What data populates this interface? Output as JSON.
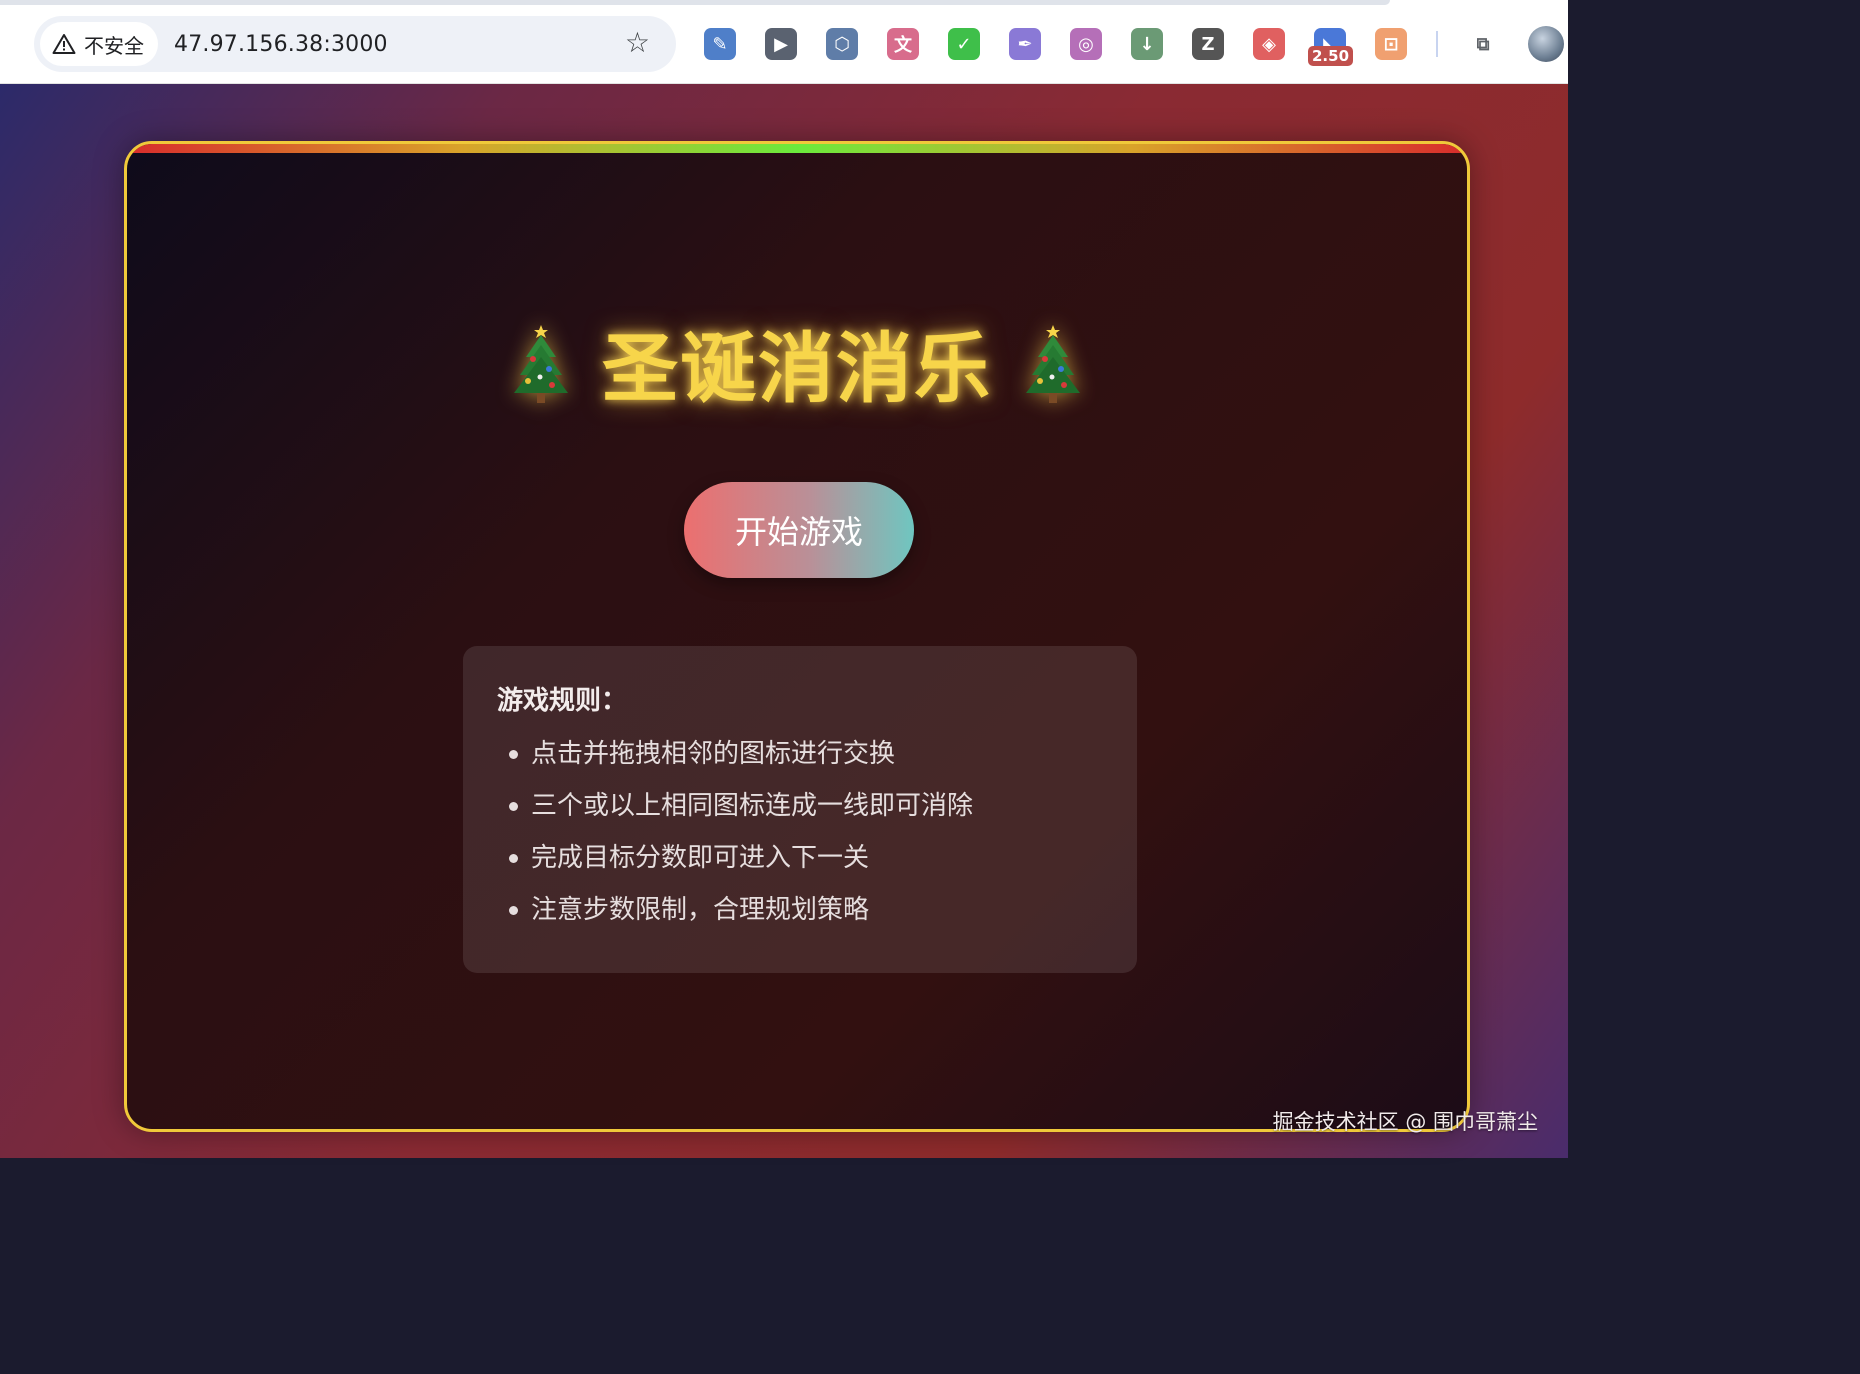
{
  "browser": {
    "security_label": "不安全",
    "url": "47.97.156.38:3000",
    "extensions": [
      {
        "name": "pen-extension-icon",
        "glyph": "✎",
        "color": "#4f7fc9"
      },
      {
        "name": "video-extension-icon",
        "glyph": "▶",
        "color": "#5a6270"
      },
      {
        "name": "hex-extension-icon",
        "glyph": "⬡",
        "color": "#5f7da8"
      },
      {
        "name": "translate-extension-icon",
        "glyph": "文",
        "color": "#d86c8c"
      },
      {
        "name": "check-extension-icon",
        "glyph": "✓",
        "color": "#3fbf4a"
      },
      {
        "name": "quill-extension-icon",
        "glyph": "✒",
        "color": "#8a79d6"
      },
      {
        "name": "screenshot-extension-icon",
        "glyph": "◎",
        "color": "#b56fb8"
      },
      {
        "name": "download-extension-icon",
        "glyph": "↓",
        "color": "#6b9a75"
      },
      {
        "name": "zotero-extension-icon",
        "glyph": "Z",
        "color": "#555555"
      },
      {
        "name": "cast-extension-icon",
        "glyph": "◈",
        "color": "#e06060"
      },
      {
        "name": "speed-extension-icon",
        "glyph": "◣",
        "color": "#4a78d8",
        "badge": "2.50"
      },
      {
        "name": "media-extension-icon",
        "glyph": "⊡",
        "color": "#f0a070"
      },
      {
        "name": "puzzle-extensions-icon",
        "glyph": "⧉",
        "color": "#5f6368"
      }
    ]
  },
  "game": {
    "title": "圣诞消消乐",
    "start_button": "开始游戏",
    "rules_title": "游戏规则：",
    "rules": [
      "点击并拖拽相邻的图标进行交换",
      "三个或以上相同图标连成一线即可消除",
      "完成目标分数即可进入下一关",
      "注意步数限制，合理规划策略"
    ]
  },
  "watermark": "掘金技术社区 @ 围巾哥萧尘",
  "colors": {
    "title": "#f7d54a",
    "card_border": "#f0c93a",
    "button_left": "#ec6f6f",
    "button_right": "#6fc6c0"
  }
}
